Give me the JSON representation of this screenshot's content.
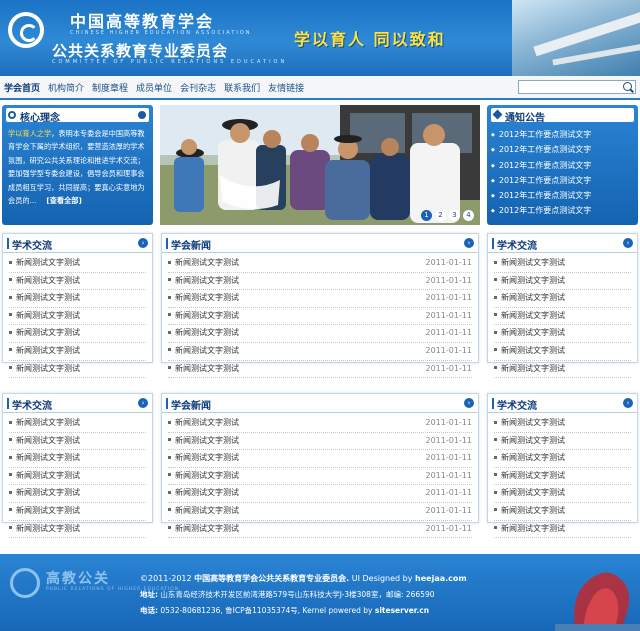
{
  "header": {
    "cn_name": "中国高等教育学会",
    "en_name": "CHINESE HIGHER EDUCATION ASSOCIATION",
    "committee": "公共关系教育专业委员会",
    "en_committee": "COMMITTEE OF PUBLIC RELATIONS EDUCATION",
    "slogan": "学以育人 同以致和"
  },
  "nav": {
    "items": [
      "学会首页",
      "机构简介",
      "制度章程",
      "成员单位",
      "会刊杂志",
      "联系我们",
      "友情链接"
    ],
    "search_placeholder": ""
  },
  "core": {
    "title": "核心理念",
    "highlight": "学以育人之学",
    "text": "，表明本专委会是中国高等教育学会下属的学术组织，要营造浓厚的学术氛围，研究公共关系理论和推进学术交流；要加强学型专委会建设，倡导会员和理事会成员相互学习，共同提高；要真心实意地为会员的...",
    "more": "[查看全部]"
  },
  "slider": {
    "pages": [
      "1",
      "2",
      "3",
      "4"
    ],
    "active": 0
  },
  "notice": {
    "title": "通知公告",
    "items": [
      "2012年工作要点测试文字",
      "2012年工作要点测试文字",
      "2012年工作要点测试文字",
      "2012年工作要点测试文字",
      "2012年工作要点测试文字",
      "2012年工作要点测试文字"
    ]
  },
  "row1": {
    "left": {
      "title": "学术交流",
      "items": [
        "新闻测试文字测试",
        "新闻测试文字测试",
        "新闻测试文字测试",
        "新闻测试文字测试",
        "新闻测试文字测试",
        "新闻测试文字测试",
        "新闻测试文字测试"
      ]
    },
    "mid": {
      "title": "学会新闻",
      "items": [
        {
          "text": "新闻测试文字测试",
          "date": "2011-01-11"
        },
        {
          "text": "新闻测试文字测试",
          "date": "2011-01-11"
        },
        {
          "text": "新闻测试文字测试",
          "date": "2011-01-11"
        },
        {
          "text": "新闻测试文字测试",
          "date": "2011-01-11"
        },
        {
          "text": "新闻测试文字测试",
          "date": "2011-01-11"
        },
        {
          "text": "新闻测试文字测试",
          "date": "2011-01-11"
        },
        {
          "text": "新闻测试文字测试",
          "date": "2011-01-11"
        }
      ]
    },
    "right": {
      "title": "学术交流",
      "items": [
        "新闻测试文字测试",
        "新闻测试文字测试",
        "新闻测试文字测试",
        "新闻测试文字测试",
        "新闻测试文字测试",
        "新闻测试文字测试",
        "新闻测试文字测试"
      ]
    }
  },
  "row2": {
    "left": {
      "title": "学术交流",
      "items": [
        "新闻测试文字测试",
        "新闻测试文字测试",
        "新闻测试文字测试",
        "新闻测试文字测试",
        "新闻测试文字测试",
        "新闻测试文字测试",
        "新闻测试文字测试"
      ]
    },
    "mid": {
      "title": "学会新闻",
      "items": [
        {
          "text": "新闻测试文字测试",
          "date": "2011-01-11"
        },
        {
          "text": "新闻测试文字测试",
          "date": "2011-01-11"
        },
        {
          "text": "新闻测试文字测试",
          "date": "2011-01-11"
        },
        {
          "text": "新闻测试文字测试",
          "date": "2011-01-11"
        },
        {
          "text": "新闻测试文字测试",
          "date": "2011-01-11"
        },
        {
          "text": "新闻测试文字测试",
          "date": "2011-01-11"
        },
        {
          "text": "新闻测试文字测试",
          "date": "2011-01-11"
        }
      ]
    },
    "right": {
      "title": "学术交流",
      "items": [
        "新闻测试文字测试",
        "新闻测试文字测试",
        "新闻测试文字测试",
        "新闻测试文字测试",
        "新闻测试文字测试",
        "新闻测试文字测试",
        "新闻测试文字测试"
      ]
    }
  },
  "footer": {
    "logo_text": "高教公关",
    "logo_en": "PUBLIC RELATIONS OF HIGHER EDUCATION",
    "copyright": "©2011-2012",
    "org": "中国高等教育学会公共关系教育专业委员会.",
    "designed_by": "UI Designed by",
    "designer": "heejaa.com",
    "address_label": "地址:",
    "address": "山东青岛经济技术开发区前湾港路579号山东科技大学J-3楼308室，邮编: 266590",
    "phone_label": "电话:",
    "phone": "0532-80681236, 鲁ICP备11035374号, Kernel powered by",
    "powered": "siteserver.cn"
  },
  "colors": {
    "primary": "#1a63b8",
    "accent": "#ffe23d"
  }
}
